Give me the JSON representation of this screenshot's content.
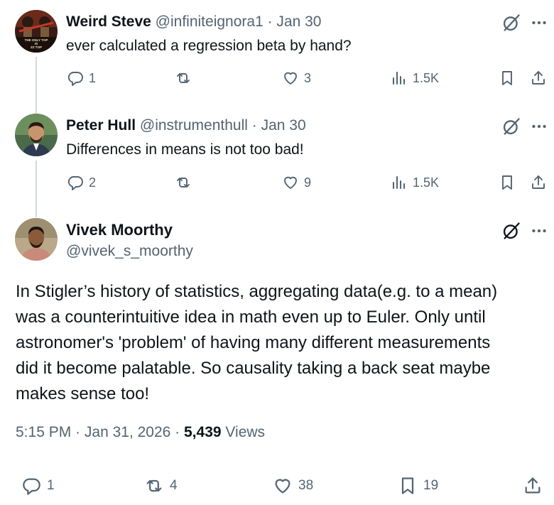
{
  "replies": [
    {
      "author_name": "Weird Steve",
      "handle": "@infiniteignora1",
      "separator": " · ",
      "date": "Jan 30",
      "text": "ever calculated a regression beta by hand?",
      "reply_count": "1",
      "retweet_count": "",
      "like_count": "3",
      "view_count": "1.5K",
      "avatar_text": [
        "THE ONLY TOP",
        "IS",
        "ZZ TOP"
      ]
    },
    {
      "author_name": "Peter Hull",
      "handle": "@instrumenthull",
      "separator": " · ",
      "date": "Jan 30",
      "text": "Differences in means is not too bad!",
      "reply_count": "2",
      "retweet_count": "",
      "like_count": "9",
      "view_count": "1.5K"
    }
  ],
  "main_post": {
    "author_name": "Vivek Moorthy",
    "handle": "@vivek_s_moorthy",
    "lines": [
      "In Stigler’s history of statistics, aggregating data(e.g. to a mean)",
      "was a counterintuitive idea in math even up to Euler. Only until",
      "astronomer's 'problem' of having many different measurements",
      "did it become palatable. So causality taking a back seat maybe",
      "makes sense too!"
    ],
    "time": "5:15 PM",
    "separator": " · ",
    "date": "Jan 31, 2026",
    "separator2": " · ",
    "views_count": "5,439",
    "views_label": " Views",
    "reply_count": "1",
    "retweet_count": "4",
    "like_count": "38",
    "bookmark_count": "19"
  },
  "colors": {
    "text": "#0f1419",
    "secondary": "#536471",
    "thread_line": "#cfd9de"
  },
  "icons": [
    "reply-icon",
    "retweet-icon",
    "like-icon",
    "views-icon",
    "bookmark-icon",
    "share-icon",
    "grok-icon",
    "more-icon"
  ]
}
